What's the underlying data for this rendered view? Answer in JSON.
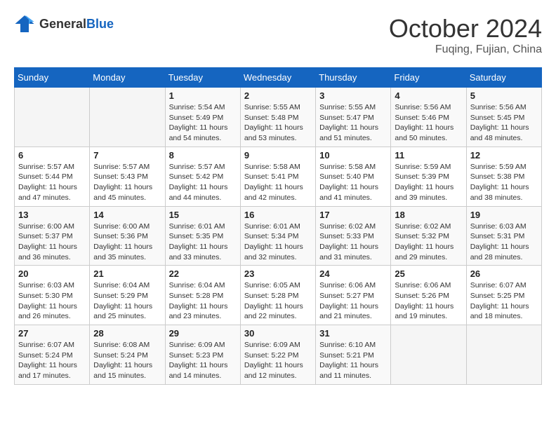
{
  "header": {
    "logo": {
      "general": "General",
      "blue": "Blue"
    },
    "month_year": "October 2024",
    "location": "Fuqing, Fujian, China"
  },
  "calendar": {
    "weekdays": [
      "Sunday",
      "Monday",
      "Tuesday",
      "Wednesday",
      "Thursday",
      "Friday",
      "Saturday"
    ],
    "weeks": [
      [
        {
          "day": "",
          "info": ""
        },
        {
          "day": "",
          "info": ""
        },
        {
          "day": "1",
          "info": "Sunrise: 5:54 AM\nSunset: 5:49 PM\nDaylight: 11 hours and 54 minutes."
        },
        {
          "day": "2",
          "info": "Sunrise: 5:55 AM\nSunset: 5:48 PM\nDaylight: 11 hours and 53 minutes."
        },
        {
          "day": "3",
          "info": "Sunrise: 5:55 AM\nSunset: 5:47 PM\nDaylight: 11 hours and 51 minutes."
        },
        {
          "day": "4",
          "info": "Sunrise: 5:56 AM\nSunset: 5:46 PM\nDaylight: 11 hours and 50 minutes."
        },
        {
          "day": "5",
          "info": "Sunrise: 5:56 AM\nSunset: 5:45 PM\nDaylight: 11 hours and 48 minutes."
        }
      ],
      [
        {
          "day": "6",
          "info": "Sunrise: 5:57 AM\nSunset: 5:44 PM\nDaylight: 11 hours and 47 minutes."
        },
        {
          "day": "7",
          "info": "Sunrise: 5:57 AM\nSunset: 5:43 PM\nDaylight: 11 hours and 45 minutes."
        },
        {
          "day": "8",
          "info": "Sunrise: 5:57 AM\nSunset: 5:42 PM\nDaylight: 11 hours and 44 minutes."
        },
        {
          "day": "9",
          "info": "Sunrise: 5:58 AM\nSunset: 5:41 PM\nDaylight: 11 hours and 42 minutes."
        },
        {
          "day": "10",
          "info": "Sunrise: 5:58 AM\nSunset: 5:40 PM\nDaylight: 11 hours and 41 minutes."
        },
        {
          "day": "11",
          "info": "Sunrise: 5:59 AM\nSunset: 5:39 PM\nDaylight: 11 hours and 39 minutes."
        },
        {
          "day": "12",
          "info": "Sunrise: 5:59 AM\nSunset: 5:38 PM\nDaylight: 11 hours and 38 minutes."
        }
      ],
      [
        {
          "day": "13",
          "info": "Sunrise: 6:00 AM\nSunset: 5:37 PM\nDaylight: 11 hours and 36 minutes."
        },
        {
          "day": "14",
          "info": "Sunrise: 6:00 AM\nSunset: 5:36 PM\nDaylight: 11 hours and 35 minutes."
        },
        {
          "day": "15",
          "info": "Sunrise: 6:01 AM\nSunset: 5:35 PM\nDaylight: 11 hours and 33 minutes."
        },
        {
          "day": "16",
          "info": "Sunrise: 6:01 AM\nSunset: 5:34 PM\nDaylight: 11 hours and 32 minutes."
        },
        {
          "day": "17",
          "info": "Sunrise: 6:02 AM\nSunset: 5:33 PM\nDaylight: 11 hours and 31 minutes."
        },
        {
          "day": "18",
          "info": "Sunrise: 6:02 AM\nSunset: 5:32 PM\nDaylight: 11 hours and 29 minutes."
        },
        {
          "day": "19",
          "info": "Sunrise: 6:03 AM\nSunset: 5:31 PM\nDaylight: 11 hours and 28 minutes."
        }
      ],
      [
        {
          "day": "20",
          "info": "Sunrise: 6:03 AM\nSunset: 5:30 PM\nDaylight: 11 hours and 26 minutes."
        },
        {
          "day": "21",
          "info": "Sunrise: 6:04 AM\nSunset: 5:29 PM\nDaylight: 11 hours and 25 minutes."
        },
        {
          "day": "22",
          "info": "Sunrise: 6:04 AM\nSunset: 5:28 PM\nDaylight: 11 hours and 23 minutes."
        },
        {
          "day": "23",
          "info": "Sunrise: 6:05 AM\nSunset: 5:28 PM\nDaylight: 11 hours and 22 minutes."
        },
        {
          "day": "24",
          "info": "Sunrise: 6:06 AM\nSunset: 5:27 PM\nDaylight: 11 hours and 21 minutes."
        },
        {
          "day": "25",
          "info": "Sunrise: 6:06 AM\nSunset: 5:26 PM\nDaylight: 11 hours and 19 minutes."
        },
        {
          "day": "26",
          "info": "Sunrise: 6:07 AM\nSunset: 5:25 PM\nDaylight: 11 hours and 18 minutes."
        }
      ],
      [
        {
          "day": "27",
          "info": "Sunrise: 6:07 AM\nSunset: 5:24 PM\nDaylight: 11 hours and 17 minutes."
        },
        {
          "day": "28",
          "info": "Sunrise: 6:08 AM\nSunset: 5:24 PM\nDaylight: 11 hours and 15 minutes."
        },
        {
          "day": "29",
          "info": "Sunrise: 6:09 AM\nSunset: 5:23 PM\nDaylight: 11 hours and 14 minutes."
        },
        {
          "day": "30",
          "info": "Sunrise: 6:09 AM\nSunset: 5:22 PM\nDaylight: 11 hours and 12 minutes."
        },
        {
          "day": "31",
          "info": "Sunrise: 6:10 AM\nSunset: 5:21 PM\nDaylight: 11 hours and 11 minutes."
        },
        {
          "day": "",
          "info": ""
        },
        {
          "day": "",
          "info": ""
        }
      ]
    ]
  }
}
